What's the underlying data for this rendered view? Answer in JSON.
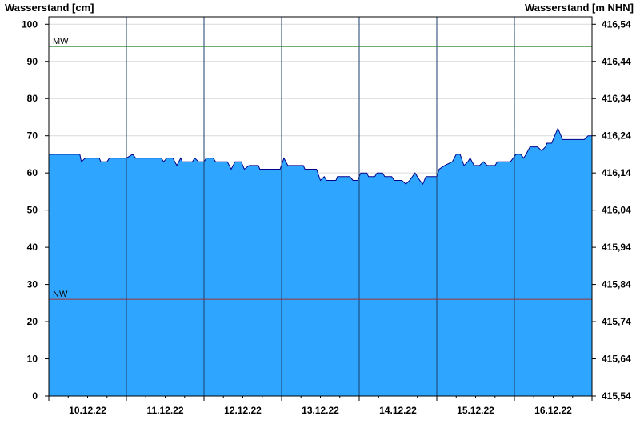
{
  "chart_data": {
    "type": "area",
    "ylabel_left": "Wasserstand [cm]",
    "ylabel_right": "Wasserstand [m NHN]",
    "ylim_left": [
      0,
      102
    ],
    "ylim_right": [
      415.54,
      416.56
    ],
    "left_ticks": [
      "0",
      "10",
      "20",
      "30",
      "40",
      "50",
      "60",
      "70",
      "80",
      "90",
      "100"
    ],
    "right_ticks": [
      "415,54",
      "415,64",
      "415,74",
      "415,84",
      "415,94",
      "416,04",
      "416,14",
      "416,24",
      "416,34",
      "416,44",
      "416,54"
    ],
    "x_labels": [
      "10.12.22",
      "11.12.22",
      "12.12.22",
      "13.12.22",
      "14.12.22",
      "15.12.22",
      "16.12.22"
    ],
    "x_range_days": [
      0,
      7
    ],
    "reference_lines": [
      {
        "name": "MW",
        "value": 94,
        "color": "#1f7a1f"
      },
      {
        "name": "NW",
        "value": 26,
        "color": "#a83232"
      }
    ],
    "series": [
      {
        "fill_color": "#2ea6ff",
        "line_color": "#00008b",
        "points": [
          [
            0.0,
            65
          ],
          [
            0.4,
            65
          ],
          [
            0.42,
            63
          ],
          [
            0.47,
            64
          ],
          [
            0.65,
            64
          ],
          [
            0.67,
            63
          ],
          [
            0.75,
            63
          ],
          [
            0.78,
            64
          ],
          [
            1.0,
            64
          ],
          [
            1.08,
            65
          ],
          [
            1.12,
            64
          ],
          [
            1.45,
            64
          ],
          [
            1.48,
            63
          ],
          [
            1.52,
            64
          ],
          [
            1.6,
            64
          ],
          [
            1.65,
            62
          ],
          [
            1.7,
            64
          ],
          [
            1.72,
            63
          ],
          [
            1.85,
            63
          ],
          [
            1.88,
            64
          ],
          [
            1.93,
            63
          ],
          [
            2.0,
            63
          ],
          [
            2.03,
            64
          ],
          [
            2.12,
            64
          ],
          [
            2.15,
            63
          ],
          [
            2.3,
            63
          ],
          [
            2.35,
            61
          ],
          [
            2.4,
            63
          ],
          [
            2.48,
            63
          ],
          [
            2.52,
            61
          ],
          [
            2.58,
            62
          ],
          [
            2.7,
            62
          ],
          [
            2.72,
            61
          ],
          [
            2.98,
            61
          ],
          [
            3.03,
            64
          ],
          [
            3.08,
            62
          ],
          [
            3.28,
            62
          ],
          [
            3.3,
            61
          ],
          [
            3.45,
            61
          ],
          [
            3.5,
            58
          ],
          [
            3.55,
            59
          ],
          [
            3.58,
            58
          ],
          [
            3.7,
            58
          ],
          [
            3.72,
            59
          ],
          [
            3.88,
            59
          ],
          [
            3.92,
            58
          ],
          [
            3.98,
            58
          ],
          [
            4.02,
            60
          ],
          [
            4.1,
            60
          ],
          [
            4.12,
            59
          ],
          [
            4.2,
            59
          ],
          [
            4.23,
            60
          ],
          [
            4.3,
            60
          ],
          [
            4.33,
            59
          ],
          [
            4.42,
            59
          ],
          [
            4.45,
            58
          ],
          [
            4.55,
            58
          ],
          [
            4.6,
            57
          ],
          [
            4.65,
            58
          ],
          [
            4.72,
            60
          ],
          [
            4.78,
            58
          ],
          [
            4.82,
            57
          ],
          [
            4.86,
            59
          ],
          [
            5.0,
            59
          ],
          [
            5.03,
            61
          ],
          [
            5.1,
            62
          ],
          [
            5.2,
            63
          ],
          [
            5.25,
            65
          ],
          [
            5.3,
            65
          ],
          [
            5.35,
            62
          ],
          [
            5.4,
            63
          ],
          [
            5.43,
            64
          ],
          [
            5.48,
            62
          ],
          [
            5.55,
            62
          ],
          [
            5.6,
            63
          ],
          [
            5.65,
            62
          ],
          [
            5.75,
            62
          ],
          [
            5.78,
            63
          ],
          [
            5.95,
            63
          ],
          [
            6.02,
            65
          ],
          [
            6.08,
            65
          ],
          [
            6.12,
            64
          ],
          [
            6.15,
            65
          ],
          [
            6.2,
            67
          ],
          [
            6.3,
            67
          ],
          [
            6.35,
            66
          ],
          [
            6.4,
            67
          ],
          [
            6.42,
            68
          ],
          [
            6.48,
            68
          ],
          [
            6.52,
            70
          ],
          [
            6.56,
            72
          ],
          [
            6.58,
            71
          ],
          [
            6.62,
            69
          ],
          [
            6.9,
            69
          ],
          [
            6.95,
            70
          ],
          [
            7.0,
            70
          ]
        ]
      }
    ]
  }
}
